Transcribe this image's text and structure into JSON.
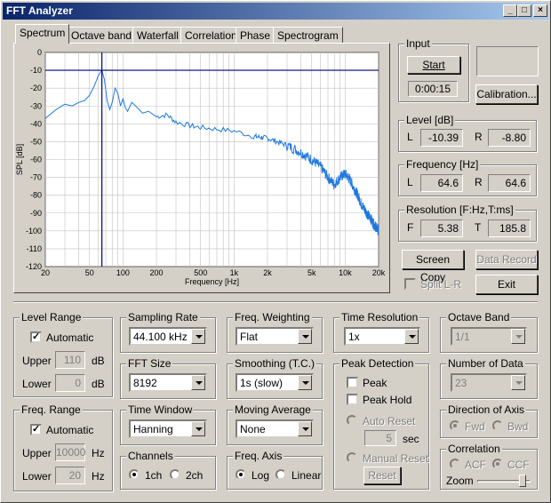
{
  "window": {
    "title": "FFT Analyzer",
    "buttons": [
      "_",
      "□",
      "×"
    ]
  },
  "tabs": [
    "Spectrum",
    "Octave band",
    "Waterfall",
    "Correlation",
    "Phase",
    "Spectrogram"
  ],
  "active_tab": "Spectrum",
  "chart_data": {
    "type": "line",
    "ylabel": "SPL [dB]",
    "xlabel": "Frequency  [Hz]",
    "xscale": "log",
    "xlim": [
      20,
      20000
    ],
    "ylim": [
      -120,
      0
    ],
    "x_ticks": [
      "20",
      "50",
      "100",
      "200",
      "500",
      "1k",
      "2k",
      "5k",
      "10k",
      "20k"
    ],
    "y_ticks": [
      "0",
      "-10",
      "-20",
      "-30",
      "-40",
      "-50",
      "-60",
      "-70",
      "-80",
      "-90",
      "-100",
      "-110",
      "-120"
    ],
    "cursor": {
      "frequency": 64.6,
      "level": -10
    },
    "series": [
      {
        "x": [
          20,
          25,
          30,
          35,
          40,
          45,
          50,
          55,
          60,
          64.6,
          68,
          72,
          76,
          80,
          85,
          90,
          95,
          100,
          105,
          110,
          120,
          130,
          140,
          150,
          170,
          200,
          250,
          300,
          400,
          500,
          700,
          1000,
          1500,
          2000,
          3000,
          4000,
          5000,
          6000,
          7000,
          8000,
          9000,
          10000,
          11000,
          12000,
          13000,
          14000,
          15000,
          16000,
          17000,
          18000,
          19000,
          20000
        ],
        "y": [
          -37,
          -32,
          -29,
          -30,
          -28,
          -27,
          -24,
          -19,
          -13,
          -10,
          -15,
          -27,
          -32,
          -28,
          -20,
          -23,
          -30,
          -26,
          -31,
          -33,
          -28,
          -30,
          -32,
          -34,
          -33,
          -36,
          -35,
          -39,
          -41,
          -42,
          -43,
          -44,
          -47,
          -48,
          -52,
          -56,
          -60,
          -64,
          -70,
          -74,
          -70,
          -68,
          -71,
          -76,
          -80,
          -85,
          -88,
          -91,
          -93,
          -96,
          -98,
          -100
        ]
      }
    ]
  },
  "input": {
    "title": "Input",
    "start_label": "Start",
    "time": "0:00:15",
    "calibration_label": "Calibration..."
  },
  "level": {
    "title": "Level [dB]",
    "l_label": "L",
    "l_value": "-10.39",
    "r_label": "R",
    "r_value": "-8.80"
  },
  "frequency": {
    "title": "Frequency [Hz]",
    "l_label": "L",
    "l_value": "64.6",
    "r_label": "R",
    "r_value": "64.6"
  },
  "resolution": {
    "title": "Resolution [F:Hz,T:ms]",
    "f_label": "F",
    "f_value": "5.38",
    "t_label": "T",
    "t_value": "185.8"
  },
  "buttons": {
    "screen_copy": "Screen Copy",
    "data_record": "Data Record",
    "split": "Split L-R",
    "exit": "Exit"
  },
  "level_range": {
    "title": "Level Range",
    "automatic": "Automatic",
    "upper_label": "Upper",
    "upper_value": "110",
    "lower_label": "Lower",
    "lower_value": "0",
    "unit": "dB"
  },
  "freq_range": {
    "title": "Freq. Range",
    "automatic": "Automatic",
    "upper_label": "Upper",
    "upper_value": "10000",
    "lower_label": "Lower",
    "lower_value": "20",
    "unit": "Hz"
  },
  "sampling_rate": {
    "title": "Sampling Rate",
    "value": "44.100 kHz"
  },
  "fft_size": {
    "title": "FFT Size",
    "value": "8192"
  },
  "time_window": {
    "title": "Time Window",
    "value": "Hanning"
  },
  "channels": {
    "title": "Channels",
    "opt1": "1ch",
    "opt2": "2ch"
  },
  "freq_weighting": {
    "title": "Freq. Weighting",
    "value": "Flat"
  },
  "smoothing": {
    "title": "Smoothing (T.C.)",
    "value": "1s (slow)"
  },
  "moving_average": {
    "title": "Moving Average",
    "value": "None"
  },
  "freq_axis": {
    "title": "Freq. Axis",
    "opt1": "Log",
    "opt2": "Linear"
  },
  "time_resolution": {
    "title": "Time Resolution",
    "value": "1x"
  },
  "peak_detection": {
    "title": "Peak Detection",
    "peak": "Peak",
    "peak_hold": "Peak Hold",
    "auto_reset": "Auto Reset",
    "seconds": "5",
    "sec": "sec",
    "manual_reset": "Manual Reset",
    "reset": "Reset"
  },
  "octave_band": {
    "title": "Octave Band",
    "value": "1/1"
  },
  "number_of_data": {
    "title": "Number of Data",
    "value": "23"
  },
  "direction": {
    "title": "Direction of Axis",
    "opt1": "Fwd",
    "opt2": "Bwd"
  },
  "correlation": {
    "title": "Correlation",
    "opt1": "ACF",
    "opt2": "CCF",
    "zoom": "Zoom"
  }
}
